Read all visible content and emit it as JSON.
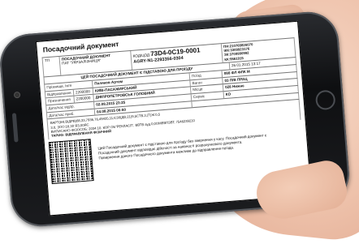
{
  "ticket": {
    "title": "Посадочний документ",
    "header": {
      "doc_type": "ПОСАДОЧНИЙ ДОКУМЕНТ",
      "issuer": "ПАТ \"УКРЗАЛІЗНИЦЯ\"",
      "code_label": "КОД/ЦОД",
      "doc_number": "73D4-0C19-0001",
      "barcode_number": "AGRY-N1-2293356-0304",
      "pn": "ПН:210765826070",
      "ikk": "ІКК:3309923176",
      "zk": "ЗК:3709990992",
      "kk": "КК:9561915"
    },
    "notice_line": "ЦЕЙ ПОСАДОЧНИЙ ДОКУМЕНТ Є ПІДСТАВОЮ ДЛЯ ПРОЇЗДУ",
    "notice_date": "26.01.2015 13:17",
    "rows": [
      {
        "label": "Прізвище, Ім'я",
        "value": "Поляков Артем",
        "label2": "Поїзд",
        "value2": "088 ФЛ ФЛК М"
      },
      {
        "label": "Відправлення",
        "code": "2200000",
        "value": "КИЇВ-ПАСАЖИРСЬКИЙ",
        "label2": "Вагон",
        "value2": "03 П/В ПРАЦ"
      },
      {
        "label": "Призначення",
        "code": "2200000",
        "value": "ДНІПРОПЕТРОВСЬК ГОЛОВНИЙ",
        "label2": "Місце",
        "value2": "028 Нижнє"
      },
      {
        "label": "Дата/час відпр.",
        "value": "02.08.2015 23:25",
        "label2": "Сервіс",
        "value2": "КО"
      },
      {
        "label": "Дата/час приб.",
        "value": "04.08.2015 06:50",
        "label2": "",
        "value2": ""
      }
    ],
    "route_text": "ВАРТ(ІНІ,ВІДРВ)88,33,7936,76,49435,11,ЄЗ0(ДВ,21)9,5СТВ,3,(Т)Ж:0,5",
    "route_text2": "3.0, ЗОО:16,30 ЯЗ,00ЯС",
    "route_text3": "ВИПИСАНО-ФІЗОСОБ: 2034.10, КОР ОБ\"РЕКЛАСЛ\", ВВТВ ауд.0,0ОМЕВПЗВТ, 7546239210",
    "paid_label": "ТАРИФ: ВІДПРАВЛЕННЯ ФІЗИЧНИЙ",
    "qr_note_line1": "Цей Посадочний документ є підставою для проїзду без звернення у касу. Посадочний документ є",
    "qr_note_line2": "Посадочний документ відповідає дійсності за наявності розрахункового документа.",
    "qr_note_line3": "Повернення даного Посадочного документа можливе до відправлення поїзда."
  }
}
